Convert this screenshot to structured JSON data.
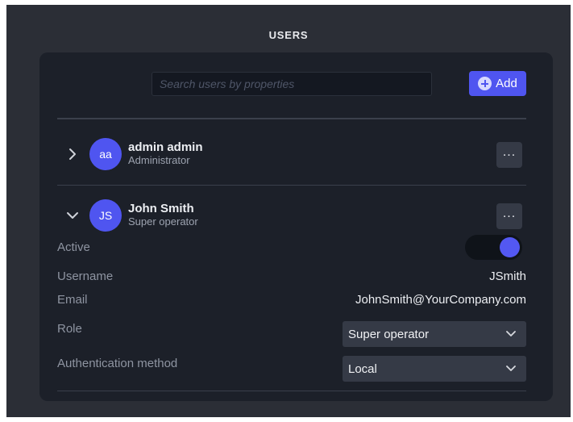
{
  "header": {
    "title": "USERS"
  },
  "search": {
    "placeholder": "Search users by properties",
    "value": ""
  },
  "toolbar": {
    "add_label": "Add"
  },
  "users": [
    {
      "initials": "aa",
      "name": "admin admin",
      "role": "Administrator",
      "expanded": false,
      "more": "..."
    },
    {
      "initials": "JS",
      "name": "John Smith",
      "role": "Super operator",
      "expanded": true,
      "more": "..."
    }
  ],
  "details": {
    "active_label": "Active",
    "active": true,
    "username_label": "Username",
    "username": "JSmith",
    "email_label": "Email",
    "email": "JohnSmith@YourCompany.com",
    "role_label": "Role",
    "role_value": "Super operator",
    "auth_label": "Authentication method",
    "auth_value": "Local"
  },
  "colors": {
    "accent": "#4f55f0",
    "background": "#2b2e36",
    "panel": "#1c2029"
  },
  "icons": {
    "add": "plus-circle-icon",
    "collapsed": "chevron-right-icon",
    "expanded": "chevron-down-icon",
    "more": "more-horizontal-icon",
    "select": "chevron-down-icon"
  }
}
